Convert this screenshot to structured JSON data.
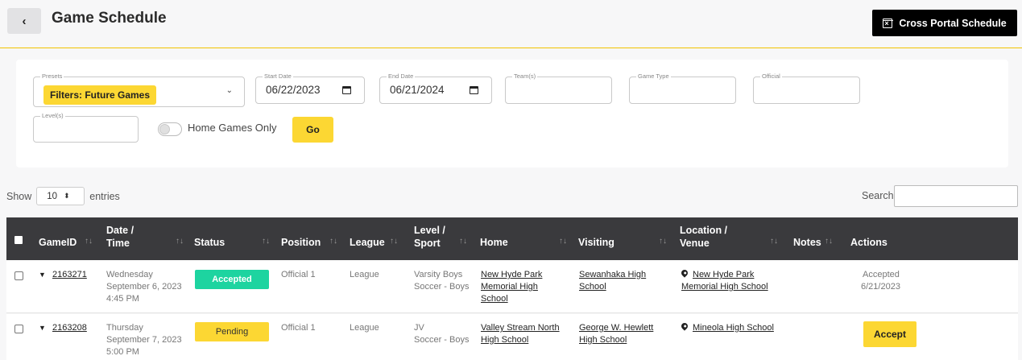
{
  "header": {
    "back_label": "‹",
    "title": "Game Schedule",
    "cross_portal_label": "Cross Portal Schedule"
  },
  "filters": {
    "presets_label": "Presets",
    "presets_value": "Filters: Future Games",
    "start_date_label": "Start Date",
    "start_date_value": "06/22/2023",
    "end_date_label": "End Date",
    "end_date_value": "06/21/2024",
    "teams_label": "Team(s)",
    "game_type_label": "Game Type",
    "official_label": "Official",
    "levels_label": "Level(s)",
    "home_games_only_label": "Home Games Only",
    "home_games_only": false,
    "go_label": "Go"
  },
  "table_controls": {
    "show_label": "Show",
    "entries_value": "10",
    "entries_label": "entries",
    "search_label": "Search:"
  },
  "columns": {
    "gameid": "GameID",
    "datetime_1": "Date /",
    "datetime_2": "Time",
    "status": "Status",
    "position": "Position",
    "league": "League",
    "level_1": "Level /",
    "level_2": "Sport",
    "home": "Home",
    "visiting": "Visiting",
    "location_1": "Location /",
    "location_2": "Venue",
    "notes": "Notes",
    "actions": "Actions",
    "sort_glyph": "↑↓"
  },
  "rows": [
    {
      "game_id": "2163271",
      "day": "Wednesday",
      "date": "September 6, 2023",
      "time": "4:45 PM",
      "status": "Accepted",
      "position": "Official 1",
      "league": "League",
      "level": "Varsity Boys",
      "sport": "Soccer - Boys",
      "home_1": "New Hyde Park",
      "home_2": "Memorial High",
      "home_3": "School",
      "visiting_1": "Sewanhaka High",
      "visiting_2": "School",
      "venue_1": "New Hyde Park",
      "venue_2": "Memorial High School",
      "action_1": "Accepted",
      "action_2": "6/21/2023"
    },
    {
      "game_id": "2163208",
      "day": "Thursday",
      "date": "September 7, 2023",
      "time": "5:00 PM",
      "status": "Pending",
      "position": "Official 1",
      "league": "League",
      "level": "JV",
      "sport": "Soccer - Boys",
      "home_1": "Valley Stream North",
      "home_2": "High School",
      "visiting_1": "George W. Hewlett",
      "visiting_2": "High School",
      "venue_1": "Mineola High School",
      "action_button": "Accept"
    }
  ]
}
